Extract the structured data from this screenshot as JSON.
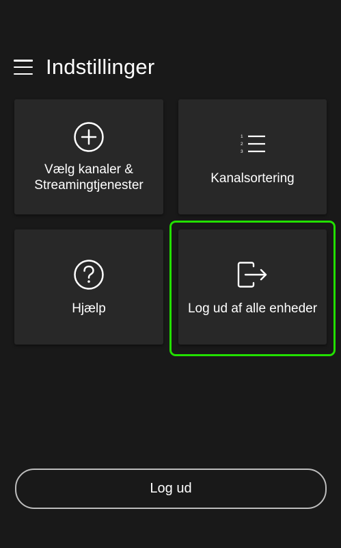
{
  "header": {
    "menu_icon": "hamburger-menu-icon",
    "title": "Indstillinger"
  },
  "tiles": [
    {
      "icon": "plus-circle-icon",
      "label": "Vælg kanaler &\nStreamingtjenester"
    },
    {
      "icon": "numbered-list-icon",
      "label": "Kanalsortering",
      "list_numbers": [
        "1",
        "2",
        "3"
      ]
    },
    {
      "icon": "question-circle-icon",
      "label": "Hjælp"
    },
    {
      "icon": "logout-icon",
      "label": "Log ud af alle enheder",
      "focused": true
    }
  ],
  "logout_button": {
    "label": "Log ud"
  },
  "colors": {
    "background": "#191919",
    "tile": "#282828",
    "focus_ring": "#22e000",
    "text": "#ffffff"
  }
}
